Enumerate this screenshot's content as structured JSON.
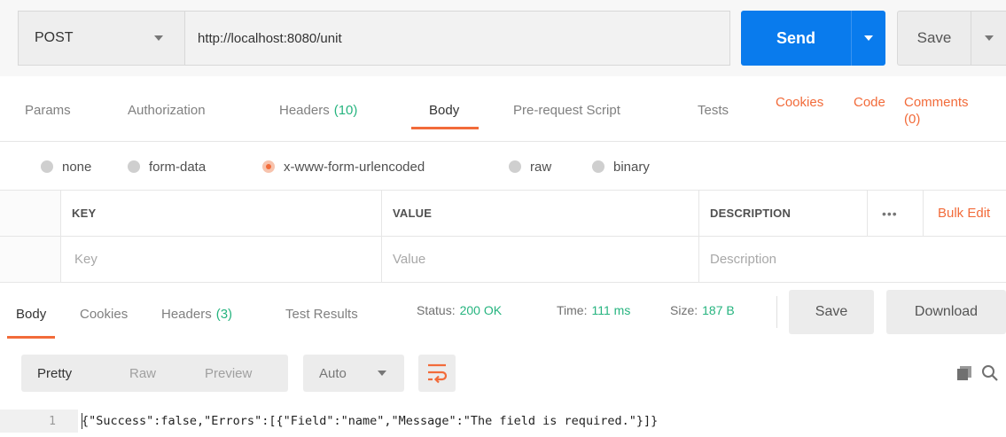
{
  "request": {
    "method": "POST",
    "url": "http://localhost:8080/unit",
    "send_label": "Send",
    "save_label": "Save"
  },
  "request_tabs": [
    {
      "label": "Params",
      "count": ""
    },
    {
      "label": "Authorization",
      "count": ""
    },
    {
      "label": "Headers",
      "count": "(10)"
    },
    {
      "label": "Body",
      "count": ""
    },
    {
      "label": "Pre-request Script",
      "count": ""
    },
    {
      "label": "Tests",
      "count": ""
    }
  ],
  "right_links": {
    "cookies": "Cookies",
    "code": "Code",
    "comments_line1": "Comments",
    "comments_line2": "(0)"
  },
  "body_types": [
    {
      "label": "none",
      "selected": false
    },
    {
      "label": "form-data",
      "selected": false
    },
    {
      "label": "x-www-form-urlencoded",
      "selected": true
    },
    {
      "label": "raw",
      "selected": false
    },
    {
      "label": "binary",
      "selected": false
    }
  ],
  "kv_table": {
    "headers": {
      "key": "KEY",
      "value": "VALUE",
      "description": "DESCRIPTION"
    },
    "placeholders": {
      "key": "Key",
      "value": "Value",
      "description": "Description"
    },
    "more": "•••",
    "bulk_edit": "Bulk Edit"
  },
  "response_tabs": [
    {
      "label": "Body",
      "count": ""
    },
    {
      "label": "Cookies",
      "count": ""
    },
    {
      "label": "Headers",
      "count": "(3)"
    },
    {
      "label": "Test Results",
      "count": ""
    }
  ],
  "response_meta": {
    "status_label": "Status:",
    "status_value": "200 OK",
    "time_label": "Time:",
    "time_value": "111 ms",
    "size_label": "Size:",
    "size_value": "187 B"
  },
  "response_buttons": {
    "save": "Save",
    "download": "Download"
  },
  "view_modes": [
    "Pretty",
    "Raw",
    "Preview"
  ],
  "format": "Auto",
  "code": {
    "line_number": "1",
    "text": "{\"Success\":false,\"Errors\":[{\"Field\":\"name\",\"Message\":\"The field is required.\"}]}"
  },
  "colors": {
    "accent": "#f26b3a",
    "primary": "#097bed",
    "count": "#26b47f"
  }
}
